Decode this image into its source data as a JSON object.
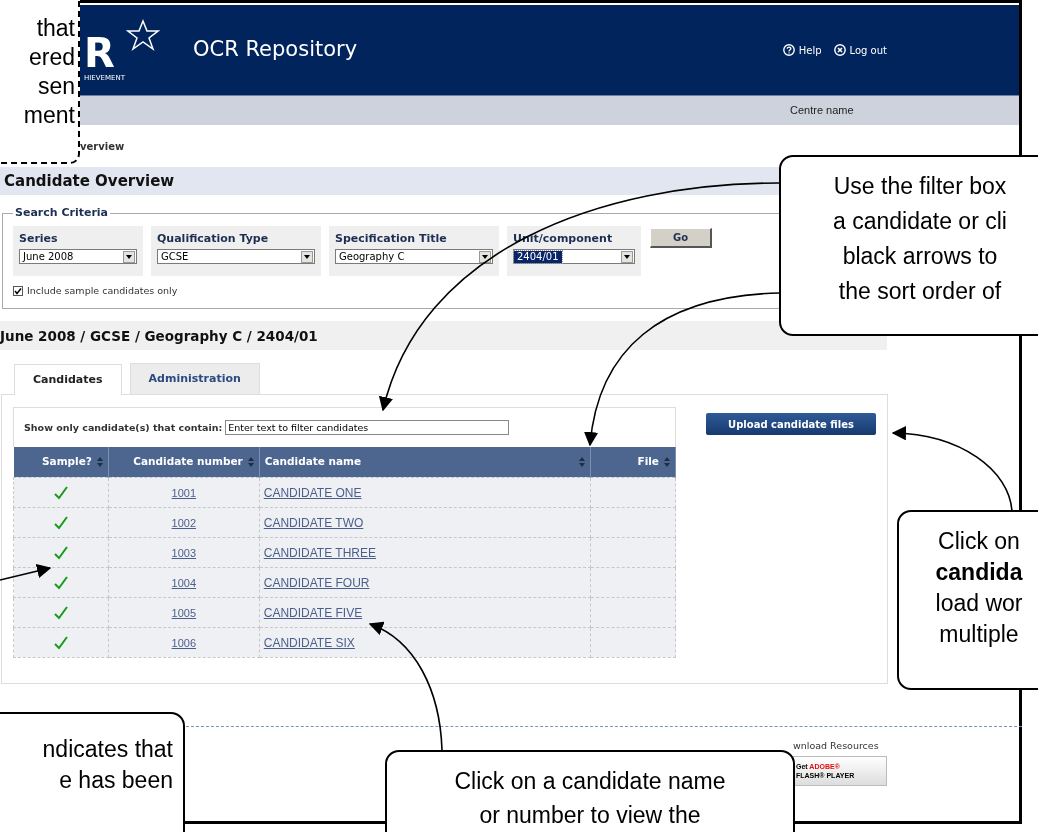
{
  "header": {
    "logo_letter": "R",
    "logo_tagline": "HIEVEMENT",
    "title": "OCR Repository",
    "links": [
      {
        "label": "Help",
        "kind": "help"
      },
      {
        "label": "Log out",
        "kind": "logout"
      }
    ]
  },
  "centre_bar": {
    "label": "Centre name"
  },
  "breadcrumb": "verview",
  "page_title": "Candidate Overview",
  "search": {
    "legend": "Search Criteria",
    "fields": [
      {
        "label": "Series",
        "value": "June 2008",
        "focused": false
      },
      {
        "label": "Qualification Type",
        "value": "GCSE",
        "focused": false
      },
      {
        "label": "Specification Title",
        "value": "Geography C",
        "focused": false
      },
      {
        "label": "Unit/component",
        "value": "2404/01",
        "focused": true
      }
    ],
    "go": "Go",
    "checkbox": {
      "label": "Include sample candidates only",
      "checked": true
    }
  },
  "summary": "June 2008 / GCSE / Geography C / 2404/01",
  "tabs": [
    {
      "label": "Candidates",
      "selected": true
    },
    {
      "label": "Administration",
      "selected": false
    }
  ],
  "filter": {
    "label": "Show only candidate(s) that contain:",
    "placeholder": "Enter text to filter candidates"
  },
  "upload_button": "Upload candidate files",
  "table": {
    "columns": [
      {
        "label": "Sample?"
      },
      {
        "label": "Candidate number"
      },
      {
        "label": "Candidate name"
      },
      {
        "label": "File"
      }
    ],
    "rows": [
      {
        "sample": true,
        "number": "1001",
        "name": "CANDIDATE ONE"
      },
      {
        "sample": true,
        "number": "1002",
        "name": "CANDIDATE TWO"
      },
      {
        "sample": true,
        "number": "1003",
        "name": "CANDIDATE THREE"
      },
      {
        "sample": true,
        "number": "1004",
        "name": "CANDIDATE FOUR"
      },
      {
        "sample": true,
        "number": "1005",
        "name": "CANDIDATE FIVE"
      },
      {
        "sample": true,
        "number": "1006",
        "name": "CANDIDATE SIX"
      }
    ]
  },
  "footer": {
    "resources": "wnload Resources",
    "flash_badge": {
      "get": "Get",
      "brand": "ADOBE®",
      "product": "FLASH® PLAYER"
    }
  },
  "callouts": [
    {
      "kind": "top-left",
      "lines": [
        "that",
        "ered",
        "sen",
        "ment"
      ]
    },
    {
      "kind": "filter",
      "lines": [
        "Use the filter box",
        "a candidate or cli",
        "black arrows to",
        "the sort order of"
      ]
    },
    {
      "kind": "upload",
      "lines": [
        "Click on",
        "**candida**",
        "load wor",
        "multiple"
      ]
    },
    {
      "kind": "sample",
      "lines": [
        "ndicates that",
        "e has been"
      ]
    },
    {
      "kind": "name",
      "lines": [
        "Click on a candidate name",
        "or number to view the"
      ]
    }
  ]
}
